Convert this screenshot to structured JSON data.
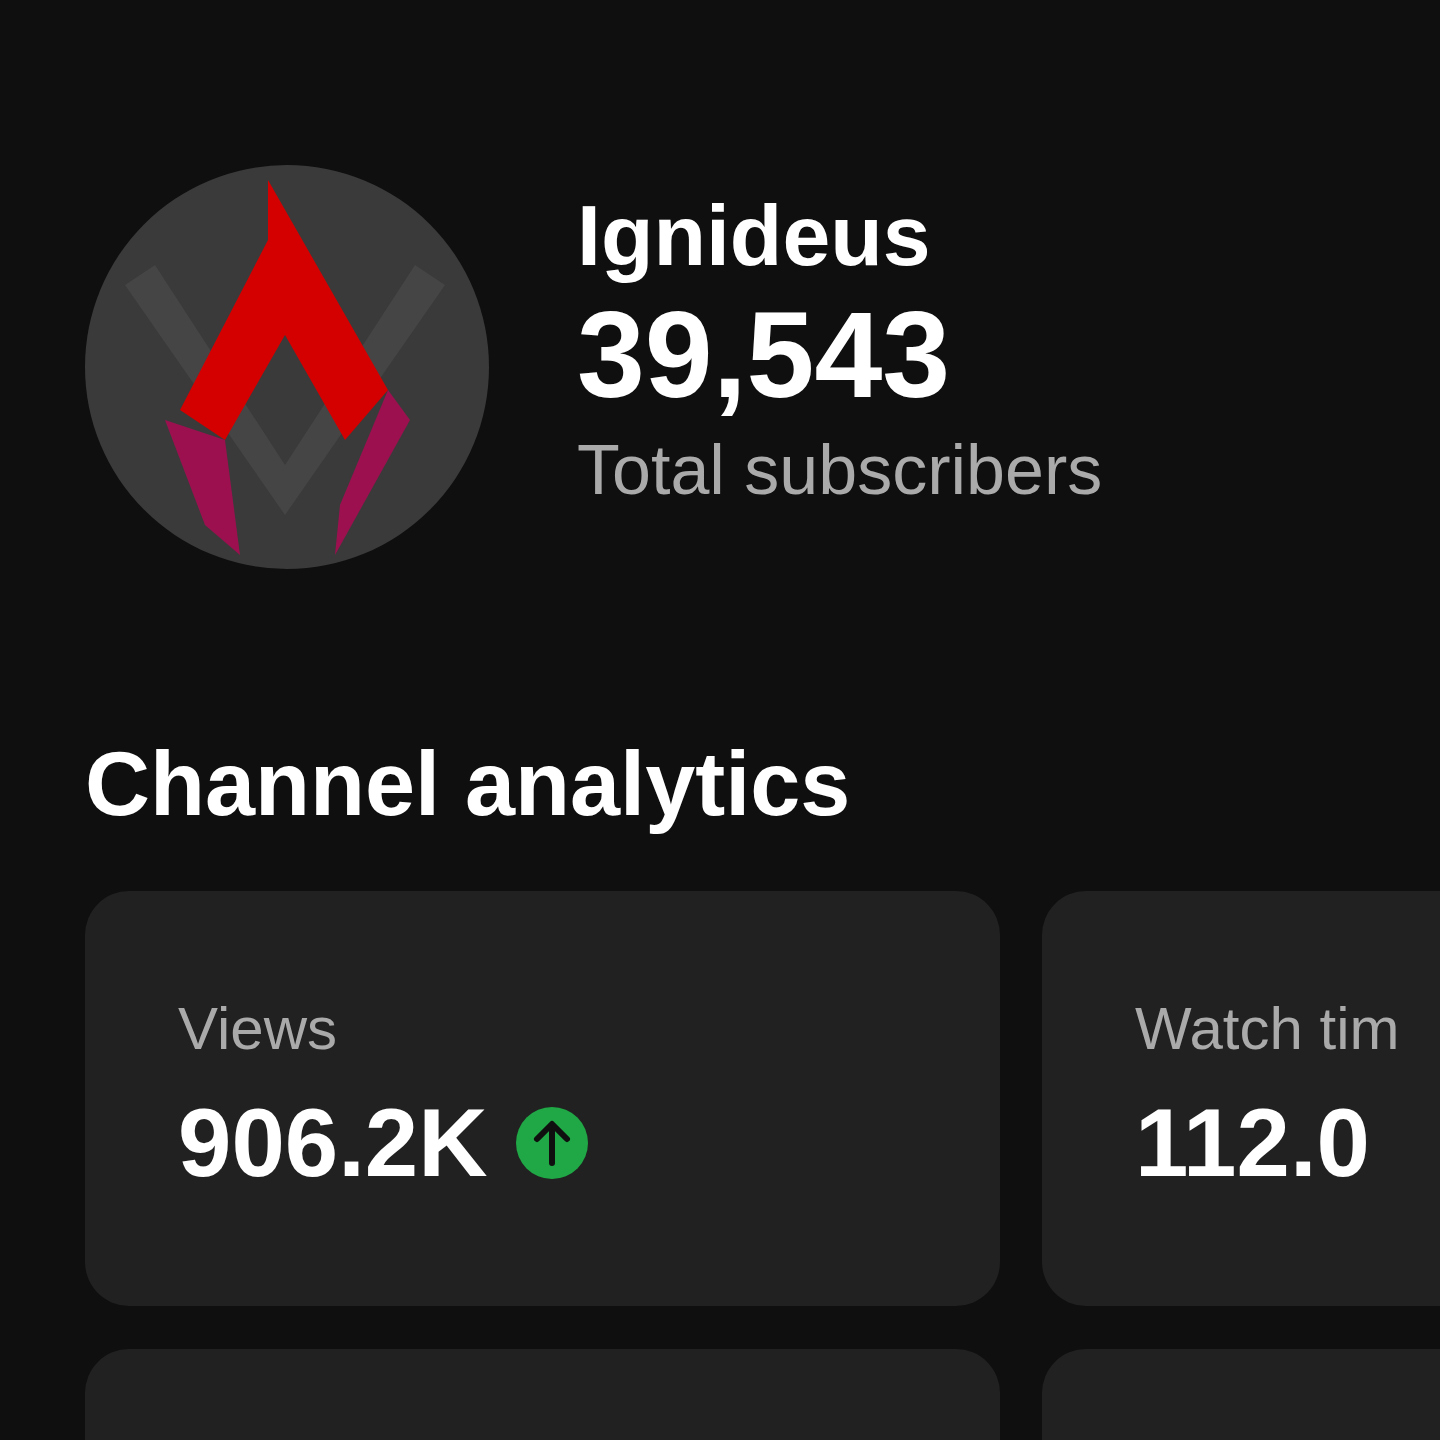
{
  "channel": {
    "name": "Ignideus",
    "subscribers": "39,543",
    "subscribers_label": "Total subscribers"
  },
  "section_title": "Channel analytics",
  "cards": [
    {
      "label": "Views",
      "value": "906.2K",
      "rising": true
    },
    {
      "label": "Watch tim",
      "value": "112.0",
      "rising": false
    }
  ]
}
